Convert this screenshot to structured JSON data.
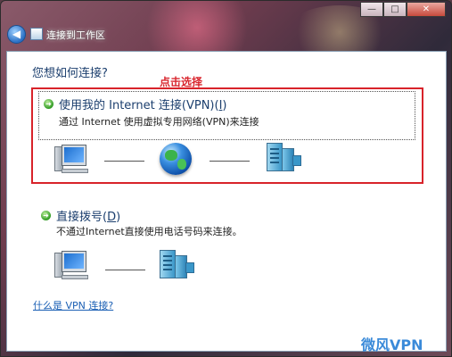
{
  "window": {
    "title": "连接到工作区",
    "controls": {
      "minimize": "—",
      "maximize": "□",
      "close": "✕"
    }
  },
  "question": "您想如何连接?",
  "annotation": "点击选择",
  "options": [
    {
      "title_main": "使用我的 Internet 连接(VPN)(",
      "title_key": "I",
      "title_end": ")",
      "description": "通过 Internet 使用虚拟专用网络(VPN)来连接",
      "icons": [
        "computer-icon",
        "globe-icon",
        "server-icon"
      ]
    },
    {
      "title_main": "直接拨号(",
      "title_key": "D",
      "title_end": ")",
      "description": "不通过Internet直接使用电话号码来连接。",
      "icons": [
        "computer-icon",
        "server-icon"
      ]
    }
  ],
  "help_link": "什么是 VPN 连接?",
  "watermark": "微风VPN"
}
